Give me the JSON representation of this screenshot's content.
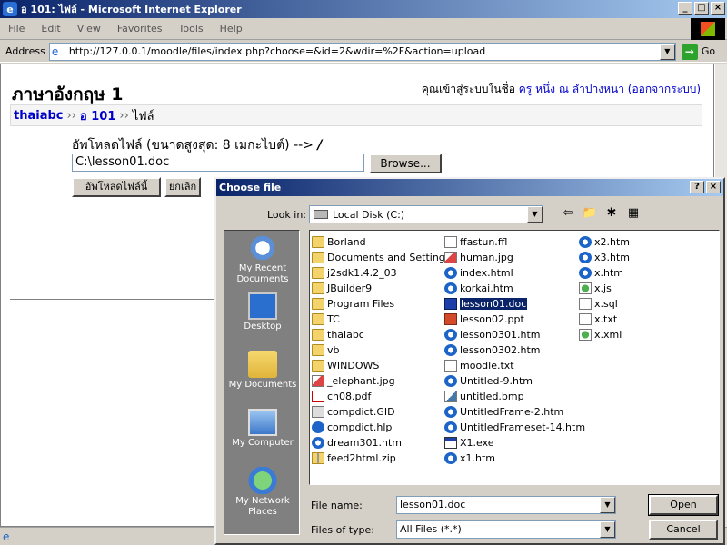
{
  "window": {
    "title": "อ 101: ไฟล์ - Microsoft Internet Explorer",
    "buttons": {
      "minimize": "_",
      "maximize": "□",
      "close": "×"
    }
  },
  "menu": [
    "File",
    "Edit",
    "View",
    "Favorites",
    "Tools",
    "Help"
  ],
  "address": {
    "label": "Address",
    "url": "http://127.0.0.1/moodle/files/index.php?choose=&id=2&wdir=%2F&action=upload",
    "go_label": "Go"
  },
  "page": {
    "course_title": "ภาษาอังกฤษ 1",
    "login_prefix": "คุณเข้าสู่ระบบในชื่อ",
    "login_user": "ครู หนึ่ง ณ ลำปางหนา",
    "logout": "(ออกจากระบบ)",
    "breadcrumb": {
      "site": "thaiabc",
      "sep": "››",
      "course": "อ 101",
      "current": "ไฟล์"
    },
    "upload_label": "อัพโหลดไฟล์ (ขนาดสูงสุด: 8 เมกะไบต์) -->",
    "upload_label_slash": "/",
    "file_value": "C:\\lesson01.doc",
    "browse_label": "Browse...",
    "upload_button": "อัพโหลดไฟล์นี้",
    "cancel_button": "ยกเลิก"
  },
  "dialog": {
    "title": "Choose file",
    "help": "?",
    "close": "×",
    "look_in_label": "Look in:",
    "look_in_value": "Local Disk (C:)",
    "places": [
      {
        "label": "My Recent Documents",
        "icon": "recent-documents-icon"
      },
      {
        "label": "Desktop",
        "icon": "desktop-icon"
      },
      {
        "label": "My Documents",
        "icon": "my-documents-icon"
      },
      {
        "label": "My Computer",
        "icon": "my-computer-icon"
      },
      {
        "label": "My Network Places",
        "icon": "network-places-icon"
      }
    ],
    "columns": [
      [
        {
          "name": "Borland",
          "type": "folder"
        },
        {
          "name": "Documents and Settings",
          "type": "folder"
        },
        {
          "name": "j2sdk1.4.2_03",
          "type": "folder"
        },
        {
          "name": "JBuilder9",
          "type": "folder"
        },
        {
          "name": "Program Files",
          "type": "folder"
        },
        {
          "name": "TC",
          "type": "folder"
        },
        {
          "name": "thaiabc",
          "type": "folder"
        },
        {
          "name": "vb",
          "type": "folder"
        },
        {
          "name": "WINDOWS",
          "type": "folder"
        },
        {
          "name": "_elephant.jpg",
          "type": "img"
        },
        {
          "name": "ch08.pdf",
          "type": "pdf"
        },
        {
          "name": "compdict.GID",
          "type": "gid"
        },
        {
          "name": "compdict.hlp",
          "type": "hlp"
        },
        {
          "name": "dream301.htm",
          "type": "html"
        },
        {
          "name": "feed2html.zip",
          "type": "zip"
        }
      ],
      [
        {
          "name": "ffastun.ffl",
          "type": "txt"
        },
        {
          "name": "human.jpg",
          "type": "img"
        },
        {
          "name": "index.html",
          "type": "html"
        },
        {
          "name": "korkai.htm",
          "type": "html"
        },
        {
          "name": "lesson01.doc",
          "type": "doc",
          "selected": true
        },
        {
          "name": "lesson02.ppt",
          "type": "ppt"
        },
        {
          "name": "lesson0301.htm",
          "type": "html"
        },
        {
          "name": "lesson0302.htm",
          "type": "html"
        },
        {
          "name": "moodle.txt",
          "type": "txt"
        },
        {
          "name": "Untitled-9.htm",
          "type": "html"
        },
        {
          "name": "untitled.bmp",
          "type": "bmp"
        },
        {
          "name": "UntitledFrame-2.htm",
          "type": "html"
        },
        {
          "name": "UntitledFrameset-14.htm",
          "type": "html"
        },
        {
          "name": "X1.exe",
          "type": "exe"
        },
        {
          "name": "x1.htm",
          "type": "html"
        }
      ],
      [
        {
          "name": "x2.htm",
          "type": "html"
        },
        {
          "name": "x3.htm",
          "type": "html"
        },
        {
          "name": "x.htm",
          "type": "html"
        },
        {
          "name": "x.js",
          "type": "js"
        },
        {
          "name": "x.sql",
          "type": "txt"
        },
        {
          "name": "x.txt",
          "type": "txt"
        },
        {
          "name": "x.xml",
          "type": "js"
        }
      ]
    ],
    "file_name_label": "File name:",
    "file_name_value": "lesson01.doc",
    "file_type_label": "Files of type:",
    "file_type_value": "All Files (*.*)",
    "open_label": "Open",
    "cancel_label": "Cancel"
  }
}
